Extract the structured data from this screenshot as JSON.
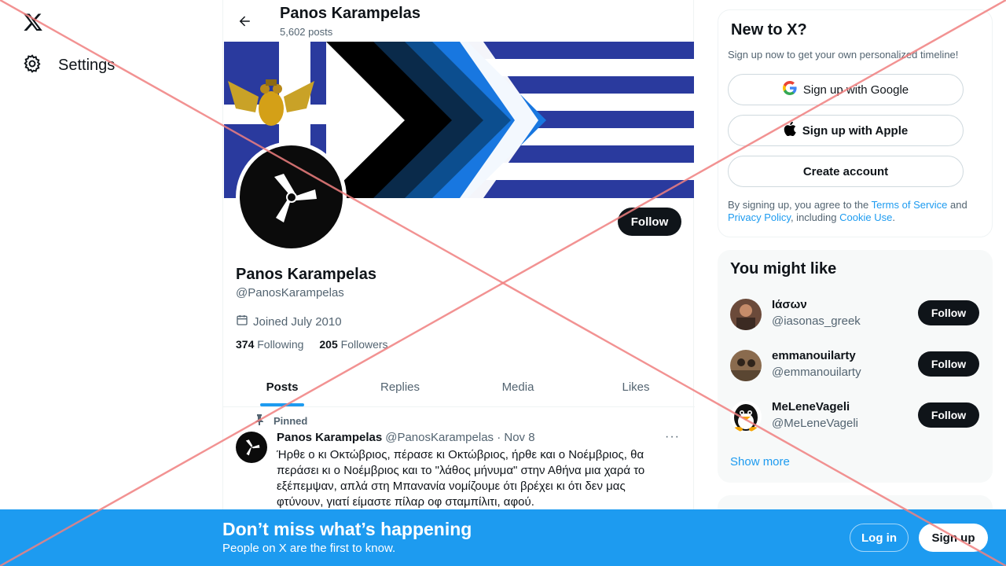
{
  "nav": {
    "logo_icon": "x-logo-icon",
    "settings_label": "Settings",
    "settings_icon": "gear-icon"
  },
  "header": {
    "title": "Panos Karampelas",
    "subtitle": "5,602 posts"
  },
  "profile": {
    "name": "Panos Karampelas",
    "handle": "@PanosKarampelas",
    "joined": "Joined July 2010",
    "following_count": "374",
    "following_label": "Following",
    "followers_count": "205",
    "followers_label": "Followers",
    "follow_label": "Follow"
  },
  "tabs": [
    {
      "label": "Posts",
      "active": true
    },
    {
      "label": "Replies",
      "active": false
    },
    {
      "label": "Media",
      "active": false
    },
    {
      "label": "Likes",
      "active": false
    }
  ],
  "tweet": {
    "pinned_label": "Pinned",
    "author": "Panos Karampelas",
    "meta": "@PanosKarampelas · Nov 8",
    "more": "···",
    "text": "Ήρθε ο κι Οκτώβριος, πέρασε κι Οκτώβριος, ήρθε και ο Νοέμβριος, θα περάσει κι ο Νοέμβριος και το \"λάθος μήνυμα\" στην Αθήνα μια χαρά το εξέπεμψαν, απλά στη Μπανανία νομίζουμε ότι βρέχει κι ότι δεν μας φτύνουν, γιατί είμαστε πίλαρ οφ σταμπίλιτι, αφού."
  },
  "signup_card": {
    "title": "New to X?",
    "subtitle": "Sign up now to get your own personalized timeline!",
    "google_label": "Sign up with Google",
    "apple_label": "Sign up with Apple",
    "create_label": "Create account",
    "terms_pre": "By signing up, you agree to the ",
    "terms_link": "Terms of Service",
    "terms_mid": " and ",
    "privacy_link": "Privacy Policy",
    "terms_mid2": ", including ",
    "cookie_link": "Cookie Use",
    "terms_end": "."
  },
  "suggestions": {
    "title": "You might like",
    "items": [
      {
        "name": "Ιάσων",
        "handle": "@iasonas_greek",
        "follow": "Follow"
      },
      {
        "name": "emmanouilarty",
        "handle": "@emmanouilarty",
        "follow": "Follow"
      },
      {
        "name": "MeLeneVageli",
        "handle": "@MeLeneVageli",
        "follow": "Follow"
      }
    ],
    "show_more": "Show more"
  },
  "bottom_bar": {
    "title": "Don’t miss what’s happening",
    "subtitle": "People on X are the first to know.",
    "login": "Log in",
    "signup": "Sign up"
  },
  "colors": {
    "accent": "#1d9bf0",
    "dark": "#0f1419",
    "muted": "#536471",
    "flag_blue": "#2a3a9e",
    "overlay_red": "#f08080"
  }
}
